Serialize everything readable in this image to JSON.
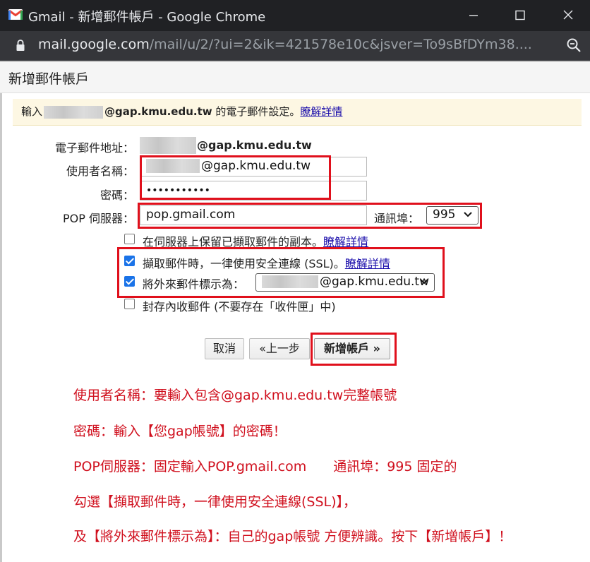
{
  "window": {
    "title": "Gmail - 新增郵件帳戶 - Google Chrome"
  },
  "address_bar": {
    "host": "mail.google.com",
    "path": "/mail/u/2/?ui=2&ik=421578e10c&jsver=To9sBfDYm38...."
  },
  "dialog": {
    "title": "新增郵件帳戶",
    "intro": {
      "prefix": "輸入",
      "domain": "@gap.kmu.edu.tw",
      "suffix": " 的電子郵件設定。",
      "link": "瞭解詳情"
    },
    "email_label": "電子郵件地址：",
    "email_domain": "@gap.kmu.edu.tw",
    "username_label": "使用者名稱：",
    "username_value": "@gap.kmu.edu.tw",
    "password_label": "密碼：",
    "password_value": "•••••••••••",
    "pop_label": "POP 伺服器：",
    "pop_value": "pop.gmail.com",
    "port_label": "通訊埠：",
    "port_value": "995",
    "options": [
      {
        "label": "在伺服器上保留已擷取郵件的副本。",
        "link": "瞭解詳情",
        "checked": false
      },
      {
        "label": "擷取郵件時，一律使用安全連線 (SSL)。",
        "link": "瞭解詳情",
        "checked": true
      },
      {
        "label": "將外來郵件標示為：",
        "select_value": "@gap.kmu.edu.tw",
        "checked": true
      },
      {
        "label": "封存內收郵件 (不要存在「收件匣」中)",
        "checked": false
      }
    ],
    "buttons": {
      "cancel": "取消",
      "back": "«上一步",
      "add": "新增帳戶 »"
    }
  },
  "notes": [
    "使用者名稱：要輸入包含@gap.kmu.edu.tw完整帳號",
    "密碼：輸入【您gap帳號】的密碼！",
    "POP伺服器：固定輸入POP.gmail.com　　通訊埠：995 固定的",
    "勾選【擷取郵件時，一律使用安全連線(SSL)】，",
    "及【將外來郵件標示為】：自己的gap帳號 方便辨識。按下【新增帳戶】！"
  ],
  "colors": {
    "annotation_red": "#e0101c",
    "checkbox_blue": "#1a73e8",
    "link": "#1a0dab"
  },
  "icons": [
    "gmail-icon",
    "minimize-icon",
    "maximize-icon",
    "close-icon",
    "lock-icon",
    "zoom-icon",
    "chevron-down-icon"
  ]
}
